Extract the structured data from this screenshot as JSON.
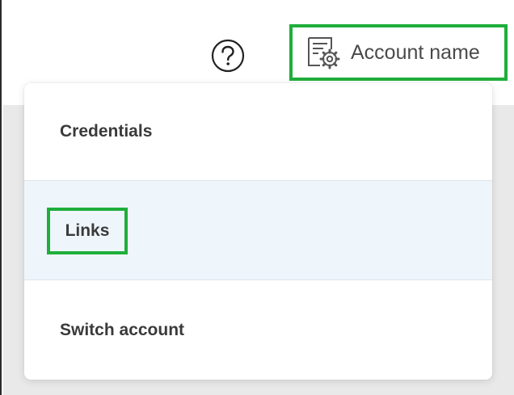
{
  "header": {
    "help_icon": "question-circle-icon",
    "account": {
      "icon": "document-gear-icon",
      "label": "Account name"
    }
  },
  "menu": {
    "items": [
      {
        "label": "Credentials"
      },
      {
        "label": "Links"
      },
      {
        "label": "Switch account"
      }
    ]
  },
  "colors": {
    "highlight_border": "#1fae3b",
    "hover_row": "#eef5fb",
    "text": "#3a3a3a"
  }
}
